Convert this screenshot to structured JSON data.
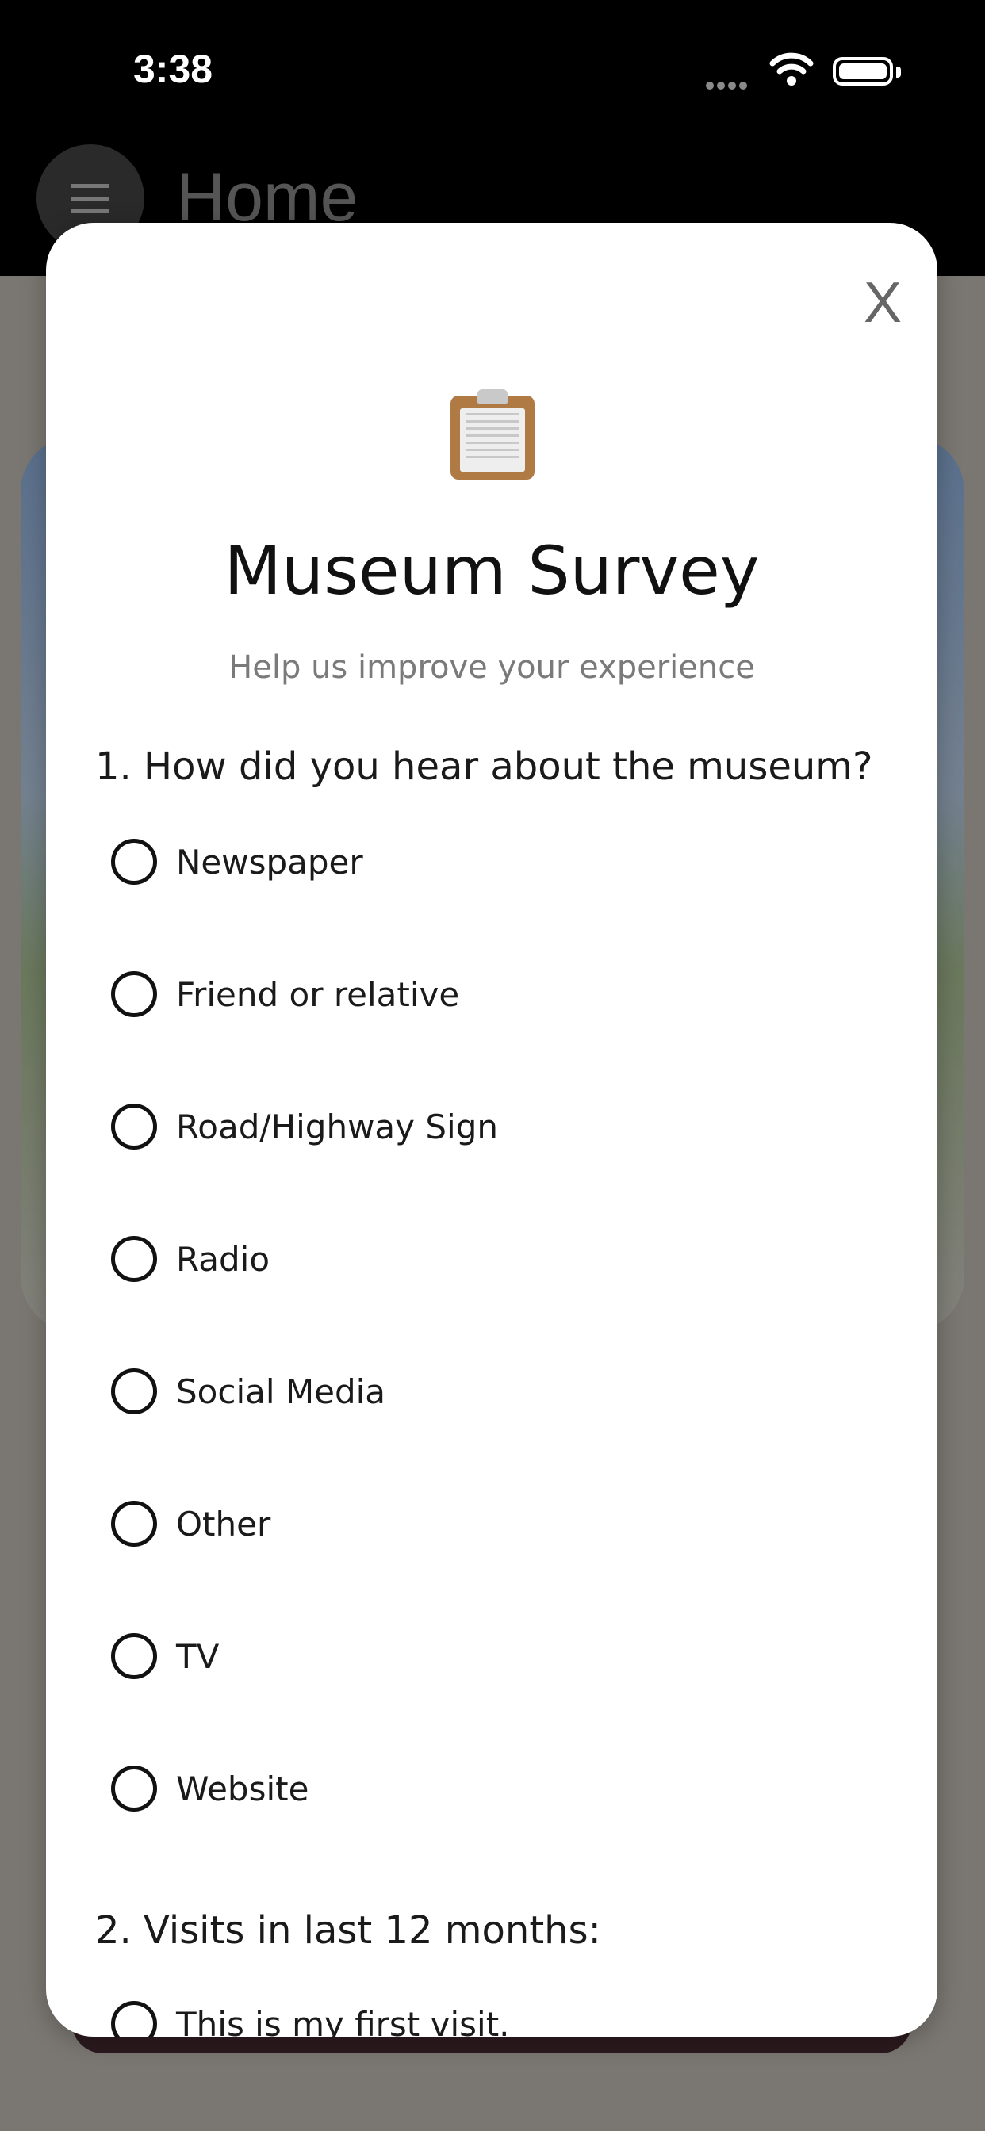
{
  "status_bar": {
    "time": "3:38"
  },
  "header": {
    "title": "Home"
  },
  "modal": {
    "close_label": "X",
    "icon": "clipboard-icon",
    "title": "Museum Survey",
    "subtitle": "Help us improve your experience",
    "question1": {
      "text": "1. How did you hear about the museum?",
      "options": [
        "Newspaper",
        "Friend or relative",
        "Road/Highway Sign",
        "Radio",
        "Social Media",
        "Other",
        "TV",
        "Website"
      ]
    },
    "question2": {
      "text": "2. Visits in last 12 months:",
      "options": [
        "This is my first visit."
      ]
    }
  }
}
